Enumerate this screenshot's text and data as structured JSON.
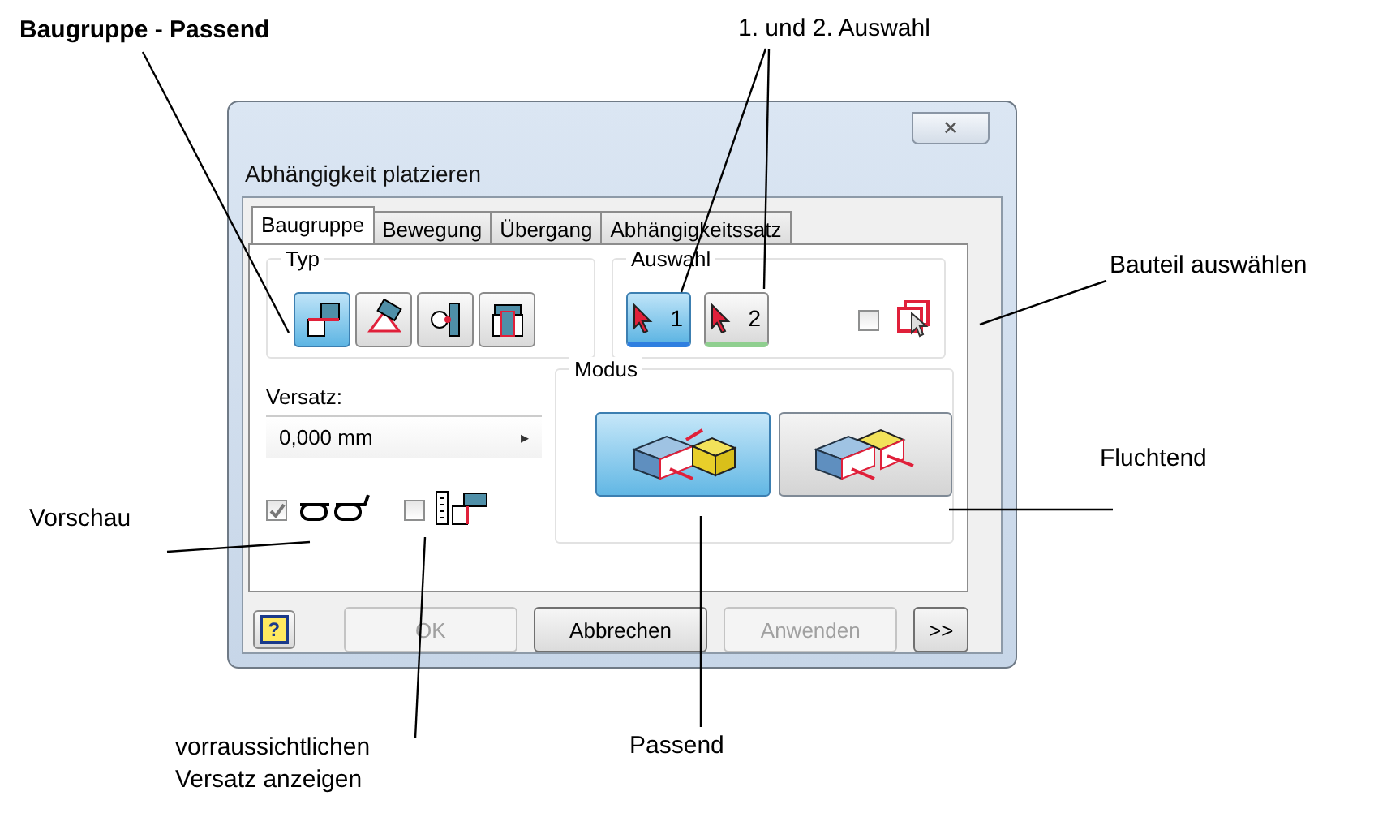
{
  "dialog": {
    "title": "Abhängigkeit platzieren",
    "close": "✕",
    "tabs": [
      {
        "label": "Baugruppe",
        "selected": true
      },
      {
        "label": "Bewegung",
        "selected": false
      },
      {
        "label": "Übergang",
        "selected": false
      },
      {
        "label": "Abhängigkeitssatz",
        "selected": false
      }
    ],
    "type_group": {
      "label": "Typ",
      "buttons": [
        {
          "kind": "mate",
          "selected": true
        },
        {
          "kind": "angle",
          "selected": false
        },
        {
          "kind": "tangent",
          "selected": false
        },
        {
          "kind": "insert",
          "selected": false
        }
      ]
    },
    "selection_group": {
      "label": "Auswahl",
      "buttons": [
        {
          "label": "1",
          "selected": true
        },
        {
          "label": "2",
          "selected": false
        }
      ],
      "pick_part_checked": false
    },
    "offset": {
      "label": "Versatz:",
      "value": "0,000 mm",
      "arrow": "▸"
    },
    "preview_checked": true,
    "predicted_offset_checked": false,
    "mode_group": {
      "label": "Modus",
      "buttons": [
        {
          "kind": "mate",
          "selected": true
        },
        {
          "kind": "flush",
          "selected": false
        }
      ]
    },
    "help": "?",
    "buttons": [
      {
        "label": "OK",
        "disabled": true
      },
      {
        "label": "Abbrechen",
        "disabled": false
      },
      {
        "label": "Anwenden",
        "disabled": true
      },
      {
        "label": ">>",
        "disabled": false
      }
    ]
  },
  "annotations": [
    {
      "kind": "heading",
      "text": "Baugruppe - Passend"
    },
    {
      "kind": "note",
      "text": "1. und 2. Auswahl"
    },
    {
      "kind": "note",
      "text": "Bauteil auswählen"
    },
    {
      "kind": "note",
      "text": "Fluchtend"
    },
    {
      "kind": "note",
      "text": "Vorschau"
    },
    {
      "kind": "note",
      "text": "vorraussichtlichen Versatz anzeigen"
    },
    {
      "kind": "note",
      "text": "Passend"
    }
  ]
}
